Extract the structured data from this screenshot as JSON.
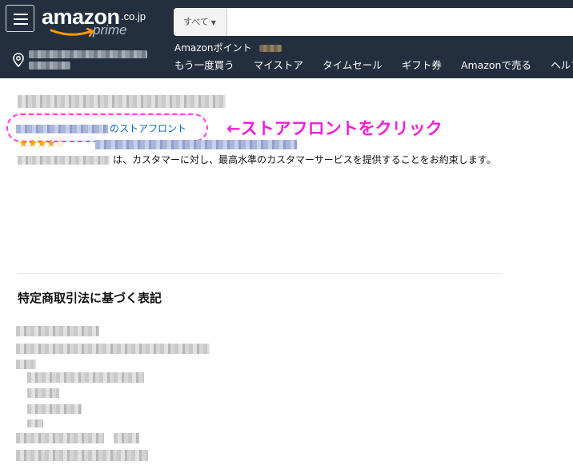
{
  "header": {
    "logo": {
      "wordmark": "amazon",
      "domain": ".co.jp",
      "prime": "prime"
    },
    "search": {
      "department": "すべて",
      "query": ""
    },
    "points_label": "Amazonポイント",
    "nav": [
      "もう一度買う",
      "マイストア",
      "タイムセール",
      "ギフト券",
      "Amazonで売る",
      "ヘルプ"
    ]
  },
  "seller": {
    "storefront_suffix": "のストアフロント",
    "rating_stars": "★★★★☆",
    "promise_text": "は、カスタマーに対し、最高水準のカスタマーサービスを提供することをお約束します。"
  },
  "annotation": {
    "text": "←ストアフロントをクリック"
  },
  "legal": {
    "title": "特定商取引法に基づく表記"
  },
  "colors": {
    "header_bg": "#232f3e",
    "annotation": "#f01fdc",
    "link": "#0066c0",
    "star": "#f5a623"
  }
}
